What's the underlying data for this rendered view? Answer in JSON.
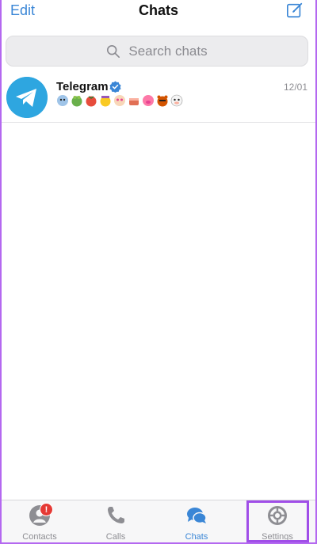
{
  "header": {
    "edit_label": "Edit",
    "title": "Chats"
  },
  "search": {
    "placeholder": "Search chats"
  },
  "chats": [
    {
      "name": "Telegram",
      "verified": true,
      "date": "12/01",
      "preview_emojis": [
        "ghost-emoji",
        "frog-emoji",
        "tomato-emoji",
        "duck-emoji",
        "face-emoji",
        "cake-emoji",
        "pig-emoji",
        "bear-emoji",
        "cow-emoji"
      ]
    }
  ],
  "tabs": [
    {
      "label": "Contacts",
      "icon": "person-icon",
      "badge": "!"
    },
    {
      "label": "Calls",
      "icon": "phone-icon"
    },
    {
      "label": "Chats",
      "icon": "chat-bubbles-icon",
      "active": true
    },
    {
      "label": "Settings",
      "icon": "gear-icon"
    }
  ],
  "colors": {
    "accent": "#3a86d6",
    "telegram_blue": "#2ea6e0",
    "badge_red": "#e53935",
    "highlight": "#a04ee8"
  }
}
